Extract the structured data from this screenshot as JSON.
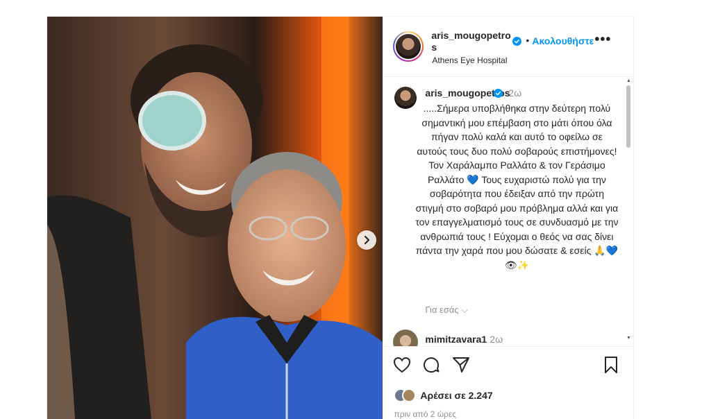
{
  "header": {
    "username": "aris_mougopetros",
    "separator": "•",
    "follow_label": "Ακολουθήστε",
    "more_label": "•••",
    "location": "Athens Eye Hospital"
  },
  "caption": {
    "username": "aris_mougopetros",
    "time": "2ω",
    "text": ".....Σήμερα υποβλήθηκα στην δεύτερη πολύ σημαντική μου επέμβαση στο μάτι όπου όλα πήγαν πολύ καλά και αυτό το οφείλω σε αυτούς τους δυο πολύ σοβαρούς επιστήμονες! Τον Χαράλαμπο Ραλλάτο & τον Γεράσιμο Ραλλάτο 💙 Τους ευχαριστώ πολύ για την σοβαρότητα που έδειξαν από την πρώτη στιγμή στο σοβαρό μου πρόβλημα αλλά και για τον επαγγελματισμό τους σε συνδυασμό με την ανθρωπιά τους ! Εύχομαι ο θεός να σας δίνει πάντα την χαρά που μου δώσατε & εσείς 🙏💙👁✨",
    "translate_label": "Για εσάς ⌵"
  },
  "comment": {
    "username": "mimitzavara1",
    "time": "2ω"
  },
  "footer": {
    "likes": "Αρέσει σε 2.247",
    "posted_ago": "πριν από 2 ώρες"
  },
  "colors": {
    "link_blue": "#0095f6",
    "muted": "#8e8e8e",
    "text": "#262626"
  },
  "icons": [
    "verified-badge-icon",
    "next-arrow-icon",
    "heart-icon",
    "comment-icon",
    "share-icon",
    "bookmark-icon"
  ]
}
